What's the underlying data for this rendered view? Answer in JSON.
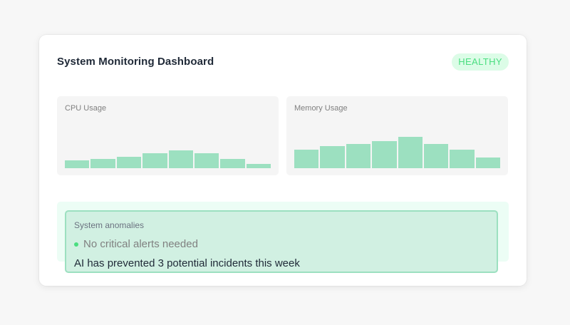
{
  "dashboard": {
    "title": "System Monitoring Dashboard",
    "status_badge": "HEALTHY"
  },
  "cpu": {
    "label": "CPU Usage",
    "bar_levels": [
      0.18,
      0.22,
      0.27,
      0.35,
      0.42,
      0.35,
      0.22,
      0.1
    ]
  },
  "memory": {
    "label": "Memory Usage",
    "bar_levels": [
      0.43,
      0.52,
      0.57,
      0.63,
      0.73,
      0.57,
      0.43,
      0.25
    ]
  },
  "anomalies": {
    "title": "System anomalies",
    "status": "No critical alerts needed",
    "ai_message": "AI has prevented 3 potential incidents this week"
  },
  "colors": {
    "bar": "#9ce0c0",
    "healthy": "#4ade80",
    "panel_bg": "#f5f5f5",
    "anomaly_bg": "#d1f0e2"
  }
}
